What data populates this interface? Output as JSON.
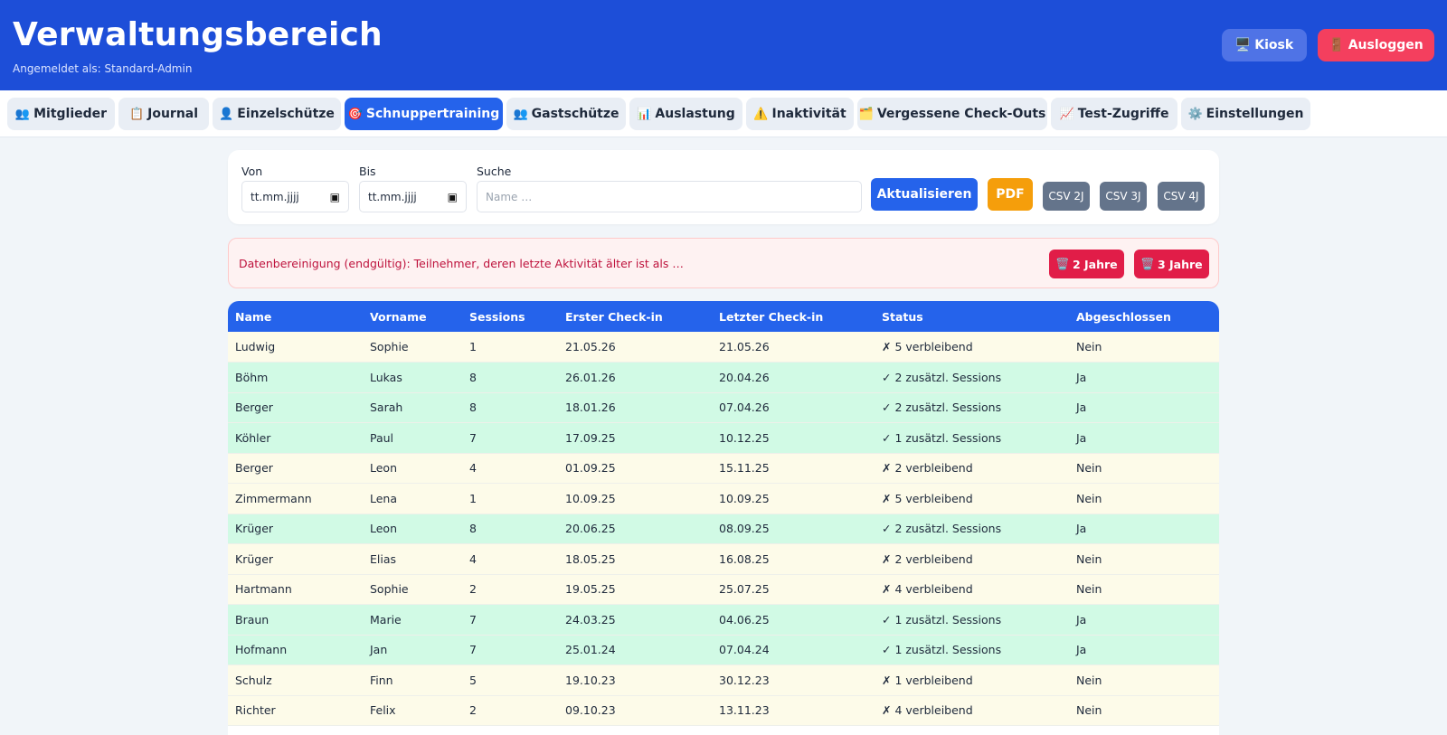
{
  "header": {
    "title": "Verwaltungsbereich",
    "subtitle": "Angemeldet als: Standard-Admin",
    "kiosk_icon": "🖥️",
    "kiosk_label": "Kiosk",
    "logout_icon": "🚪",
    "logout_label": "Ausloggen"
  },
  "tabs": [
    {
      "icon": "👥",
      "label": "Mitglieder"
    },
    {
      "icon": "📋",
      "label": "Journal"
    },
    {
      "icon": "👤",
      "label": "Einzelschütze"
    },
    {
      "icon": "🎯",
      "label": "Schnuppertraining"
    },
    {
      "icon": "👥",
      "label": "Gastschütze"
    },
    {
      "icon": "📊",
      "label": "Auslastung"
    },
    {
      "icon": "⚠️",
      "label": "Inaktivität"
    },
    {
      "icon": "🗂️",
      "label": "Vergessene Check-Outs"
    },
    {
      "icon": "📈",
      "label": "Test-Zugriffe"
    },
    {
      "icon": "⚙️",
      "label": "Einstellungen"
    }
  ],
  "active_tab": "Schnuppertraining",
  "filters": {
    "from_label": "Von",
    "from_value": "tt.mm.jjjj",
    "to_label": "Bis",
    "to_value": "tt.mm.jjjj",
    "search_label": "Suche",
    "search_placeholder": "Name …",
    "refresh_label": "Aktualisieren",
    "pdf_label": "PDF",
    "csv2_label": "CSV 2J",
    "csv3_label": "CSV 3J",
    "csv4_label": "CSV 4J"
  },
  "cleanup": {
    "text": "Datenbereinigung (endgültig): Teilnehmer, deren letzte Aktivität älter ist als …",
    "icon": "🗑️",
    "btn2_label": "2 Jahre",
    "btn3_label": "3 Jahre"
  },
  "table": {
    "columns": [
      "Name",
      "Vorname",
      "Sessions",
      "Erster Check-in",
      "Letzter Check-in",
      "Status",
      "Abgeschlossen"
    ],
    "rows": [
      {
        "name": "Ludwig",
        "vorname": "Sophie",
        "sessions": "1",
        "erster": "21.05.26",
        "letzter": "21.05.26",
        "status": "✗ 5 verbleibend",
        "abgeschlossen": "Nein"
      },
      {
        "name": "Böhm",
        "vorname": "Lukas",
        "sessions": "8",
        "erster": "26.01.26",
        "letzter": "20.04.26",
        "status": "✓ 2 zusätzl. Sessions",
        "abgeschlossen": "Ja"
      },
      {
        "name": "Berger",
        "vorname": "Sarah",
        "sessions": "8",
        "erster": "18.01.26",
        "letzter": "07.04.26",
        "status": "✓ 2 zusätzl. Sessions",
        "abgeschlossen": "Ja"
      },
      {
        "name": "Köhler",
        "vorname": "Paul",
        "sessions": "7",
        "erster": "17.09.25",
        "letzter": "10.12.25",
        "status": "✓ 1 zusätzl. Sessions",
        "abgeschlossen": "Ja"
      },
      {
        "name": "Berger",
        "vorname": "Leon",
        "sessions": "4",
        "erster": "01.09.25",
        "letzter": "15.11.25",
        "status": "✗ 2 verbleibend",
        "abgeschlossen": "Nein"
      },
      {
        "name": "Zimmermann",
        "vorname": "Lena",
        "sessions": "1",
        "erster": "10.09.25",
        "letzter": "10.09.25",
        "status": "✗ 5 verbleibend",
        "abgeschlossen": "Nein"
      },
      {
        "name": "Krüger",
        "vorname": "Leon",
        "sessions": "8",
        "erster": "20.06.25",
        "letzter": "08.09.25",
        "status": "✓ 2 zusätzl. Sessions",
        "abgeschlossen": "Ja"
      },
      {
        "name": "Krüger",
        "vorname": "Elias",
        "sessions": "4",
        "erster": "18.05.25",
        "letzter": "16.08.25",
        "status": "✗ 2 verbleibend",
        "abgeschlossen": "Nein"
      },
      {
        "name": "Hartmann",
        "vorname": "Sophie",
        "sessions": "2",
        "erster": "19.05.25",
        "letzter": "25.07.25",
        "status": "✗ 4 verbleibend",
        "abgeschlossen": "Nein"
      },
      {
        "name": "Braun",
        "vorname": "Marie",
        "sessions": "7",
        "erster": "24.03.25",
        "letzter": "04.06.25",
        "status": "✓ 1 zusätzl. Sessions",
        "abgeschlossen": "Ja"
      },
      {
        "name": "Hofmann",
        "vorname": "Jan",
        "sessions": "7",
        "erster": "25.01.24",
        "letzter": "07.04.24",
        "status": "✓ 1 zusätzl. Sessions",
        "abgeschlossen": "Ja"
      },
      {
        "name": "Schulz",
        "vorname": "Finn",
        "sessions": "5",
        "erster": "19.10.23",
        "letzter": "30.12.23",
        "status": "✗ 1 verbleibend",
        "abgeschlossen": "Nein"
      },
      {
        "name": "Richter",
        "vorname": "Felix",
        "sessions": "2",
        "erster": "09.10.23",
        "letzter": "13.11.23",
        "status": "✗ 4 verbleibend",
        "abgeschlossen": "Nein"
      }
    ]
  },
  "colors": {
    "header_bg": "#1d4ed8",
    "accent": "#2563eb",
    "danger": "#e11d48",
    "pdf": "#f59e0b",
    "csv": "#64748b",
    "row_completed": "#d1fae5",
    "row_open": "#fdfbe9"
  }
}
